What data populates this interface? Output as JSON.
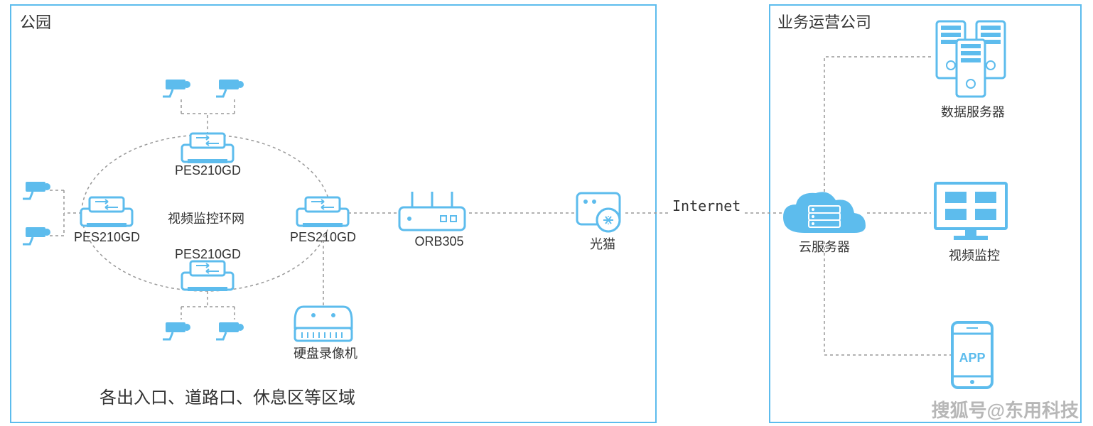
{
  "colors": {
    "primary": "#5DBCED",
    "text": "#333333"
  },
  "park": {
    "title": "公园",
    "ring_label": "视频监控环网",
    "switch_label": "PES210GD",
    "router_label": "ORB305",
    "modem_label": "光猫",
    "nvr_label": "硬盘录像机",
    "footer": "各出入口、道路口、休息区等区域"
  },
  "internet_label": "Internet",
  "ops": {
    "title": "业务运营公司",
    "cloud_label": "云服务器",
    "data_server_label": "数据服务器",
    "video_label": "视频监控",
    "app_label": "APP"
  },
  "watermark": "搜狐号@东用科技"
}
